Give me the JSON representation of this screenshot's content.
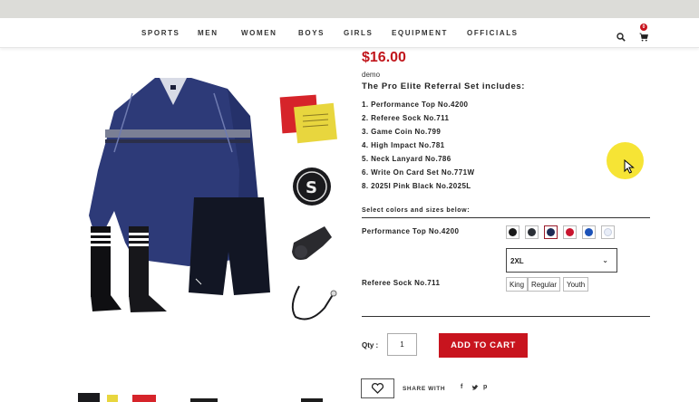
{
  "nav": {
    "items": [
      "SPORTS",
      "MEN",
      "WOMEN",
      "BOYS",
      "GIRLS",
      "EQUIPMENT",
      "OFFICIALS"
    ],
    "cart_count": "0"
  },
  "product": {
    "price": "$16.00",
    "store_label": "demo",
    "includes_title": "The Pro Elite Referral Set includes:",
    "items": [
      "1. Performance Top No.4200",
      "2. Referee Sock No.711",
      "3. Game Coin No.799",
      "4. High Impact No.781",
      "5. Neck Lanyard No.786",
      "6. Write On Card Set No.771W",
      "8. 2025I Pink Black No.2025L"
    ]
  },
  "options": {
    "select_label": "Select colors and sizes below:",
    "top_label": "Performance Top No.4200",
    "swatches": [
      "#1a1a1a",
      "#2b2f36",
      "#1d2a55",
      "#c8142e",
      "#1c52b8",
      "#e8edf7"
    ],
    "size_value": "2XL",
    "sock_label": "Referee Sock No.711",
    "sock_sizes": [
      "King",
      "Regular",
      "Youth"
    ]
  },
  "purchase": {
    "qty_label": "Qty :",
    "qty_value": "1",
    "add_to_cart": "ADD TO CART",
    "share_label": "SHARE WITH",
    "social": [
      "f",
      "𝕧",
      "p"
    ]
  },
  "colors": {
    "accent": "#c8141e",
    "price": "#c1161c"
  }
}
